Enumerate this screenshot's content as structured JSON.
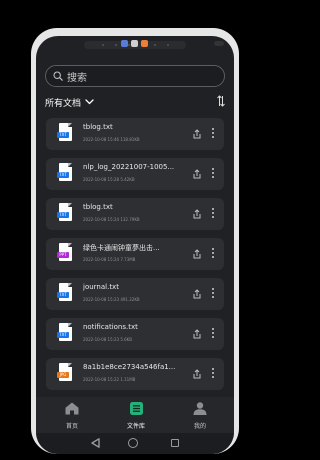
{
  "search": {
    "placeholder": "搜索"
  },
  "filter": {
    "label": "所有文档"
  },
  "files": [
    {
      "name": "tblog.txt",
      "meta": "2022-10-08 15:46 118.81KB",
      "type": "TXT",
      "tag_color": "#1a73e8"
    },
    {
      "name": "nlp_log_20221007-1005...",
      "meta": "2022-10-08 15:28 5.42KB",
      "type": "TXT",
      "tag_color": "#1a73e8"
    },
    {
      "name": "tblog.txt",
      "meta": "2022-10-08 15:24 132.79KB",
      "type": "TXT",
      "tag_color": "#1a73e8"
    },
    {
      "name": "绿色卡通闹钟童夢出击...",
      "meta": "2022-10-08 15:24 7.73MB",
      "type": "PPT",
      "tag_color": "#b02ad6"
    },
    {
      "name": "journal.txt",
      "meta": "2022-10-08 15:23 491.22KB",
      "type": "TXT",
      "tag_color": "#1a73e8"
    },
    {
      "name": "notifications.txt",
      "meta": "2022-10-08 15:23 5.6KB",
      "type": "TXT",
      "tag_color": "#1a73e8"
    },
    {
      "name": "8a1b1e8ce2734a546fa1...",
      "meta": "2022-10-08 15:22 1.11MB",
      "type": "JPG",
      "tag_color": "#e8771a"
    }
  ],
  "nav": {
    "home": "首页",
    "files": "文件库",
    "mine": "我的"
  },
  "colors": {
    "accent": "#25b07a",
    "background": "#202124",
    "card": "#2e2f33"
  }
}
